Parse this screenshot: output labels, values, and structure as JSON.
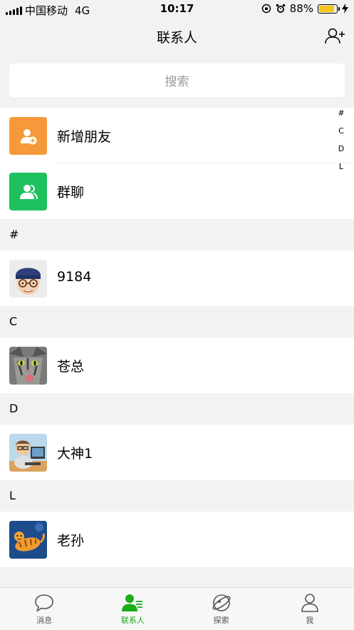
{
  "status_bar": {
    "carrier": "中国移动",
    "network": "4G",
    "time": "10:17",
    "battery_percent": "88%",
    "battery_level": 0.88
  },
  "nav": {
    "title": "联系人",
    "add_icon": "add-contact-icon"
  },
  "search": {
    "placeholder": "搜索"
  },
  "special_items": [
    {
      "label": "新增朋友",
      "icon": "new-friend-icon",
      "color": "#f6993a"
    },
    {
      "label": "群聊",
      "icon": "group-chat-icon",
      "color": "#1ec05e"
    }
  ],
  "sections": [
    {
      "letter": "#",
      "contacts": [
        {
          "name": "9184",
          "avatar": "cartoon-man-avatar"
        }
      ]
    },
    {
      "letter": "C",
      "contacts": [
        {
          "name": "苍总",
          "avatar": "cat-avatar"
        }
      ]
    },
    {
      "letter": "D",
      "contacts": [
        {
          "name": "大神1",
          "avatar": "programmer-avatar"
        }
      ]
    },
    {
      "letter": "L",
      "contacts": [
        {
          "name": "老孙",
          "avatar": "tiger-avatar"
        }
      ]
    }
  ],
  "index_bar": [
    "#",
    "C",
    "D",
    "L"
  ],
  "tabs": [
    {
      "label": "消息",
      "icon": "chat-bubble-icon",
      "active": false
    },
    {
      "label": "联系人",
      "icon": "contacts-icon",
      "active": true
    },
    {
      "label": "探索",
      "icon": "planet-icon",
      "active": false
    },
    {
      "label": "我",
      "icon": "person-icon",
      "active": false
    }
  ],
  "colors": {
    "accent": "#1aad19",
    "background": "#f2f2f2"
  }
}
